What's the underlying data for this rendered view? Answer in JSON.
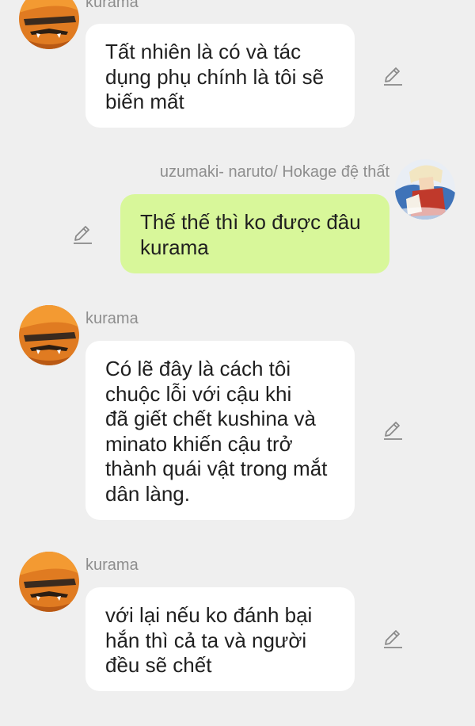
{
  "messages": [
    {
      "sender": "kurama",
      "lines": [
        "Tất nhiên là có và tác",
        "dụng phụ chính là tôi sẽ",
        "biến mất"
      ]
    },
    {
      "sender": "uzumaki- naruto/ Hokage đệ thất",
      "lines": [
        "Thế thế thì ko được đâu",
        "kurama"
      ]
    },
    {
      "sender": "kurama",
      "lines": [
        "Có lẽ đây là cách tôi",
        "chuộc lỗi với cậu khi",
        "đã giết chết kushina và",
        "minato khiến cậu trở",
        "thành quái vật trong mắt",
        "dân làng."
      ]
    },
    {
      "sender": "kurama",
      "lines": [
        "với lại nếu ko đánh bại",
        "hắn thì cả ta và người",
        "đều sẽ chết"
      ]
    }
  ],
  "icons": {
    "kurama_avatar": "kurama-fox-avatar",
    "naruto_avatar": "hokage-naruto-avatar",
    "edit": "pencil-edit-icon"
  },
  "colors": {
    "background": "#efefef",
    "bubble_other": "#ffffff",
    "bubble_me": "#d8f79a",
    "sender_text": "#8e8e8e",
    "message_text": "#1f1f1f",
    "edit_icon": "#8a8a8a"
  }
}
